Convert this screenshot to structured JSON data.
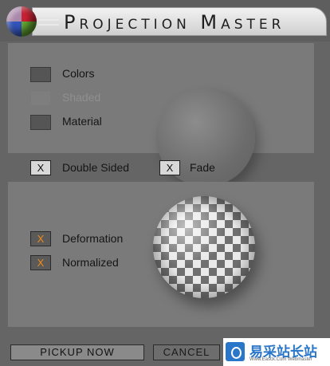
{
  "window": {
    "title": "Projection Master"
  },
  "top_panel": {
    "options": [
      {
        "label": "Colors",
        "checked": false,
        "enabled": true
      },
      {
        "label": "Shaded",
        "checked": false,
        "enabled": false
      },
      {
        "label": "Material",
        "checked": false,
        "enabled": true
      }
    ]
  },
  "middle_options": [
    {
      "label": "Double Sided",
      "mark": "X",
      "checked": true
    },
    {
      "label": "Fade",
      "mark": "X",
      "checked": true
    }
  ],
  "bottom_panel": {
    "options": [
      {
        "label": "Deformation",
        "mark": "X",
        "checked": true
      },
      {
        "label": "Normalized",
        "mark": "X",
        "checked": true
      }
    ]
  },
  "buttons": {
    "pickup": "PICKUP NOW",
    "cancel": "CANCEL"
  },
  "watermark": {
    "text": "易采站长站",
    "subtext": "Www.Easck.Com Webmaster"
  },
  "colors": {
    "accent_orange": "#f08a1a",
    "panel_gray": "#7a7a7a",
    "watermark_blue": "#2a76c8"
  },
  "icons": [
    "projection-master-logo-icon",
    "sphere-preview-icon",
    "checker-sphere-preview-icon"
  ]
}
